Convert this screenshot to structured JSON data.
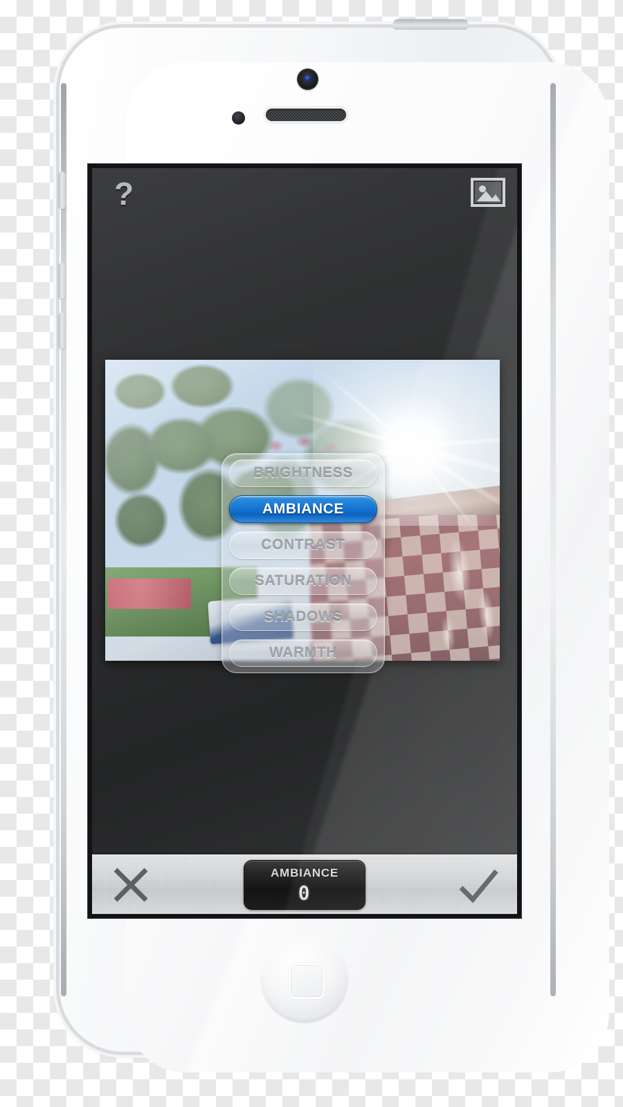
{
  "device": {
    "name": "white-smartphone",
    "camera": "front-camera",
    "sensor": "proximity-sensor",
    "speaker": "earpiece-speaker",
    "home_button": "home-button",
    "buttons": [
      "mute-switch",
      "volume-up",
      "volume-down",
      "power-button"
    ]
  },
  "app": {
    "topbar": {
      "help_label": "?",
      "gallery_icon": "image-icon"
    },
    "photo": {
      "description": "sunlit-carnival-photo"
    },
    "options_panel": {
      "items": [
        {
          "label": "BRIGHTNESS",
          "selected": false
        },
        {
          "label": "AMBIANCE",
          "selected": true
        },
        {
          "label": "CONTRAST",
          "selected": false
        },
        {
          "label": "SATURATION",
          "selected": false
        },
        {
          "label": "SHADOWS",
          "selected": false
        },
        {
          "label": "WARMTH",
          "selected": false
        }
      ],
      "selected_accent": "#1472cf"
    },
    "toolbar": {
      "cancel_icon": "close-x-icon",
      "confirm_icon": "checkmark-icon",
      "readout": {
        "label": "AMBIANCE",
        "value": "0"
      }
    }
  }
}
